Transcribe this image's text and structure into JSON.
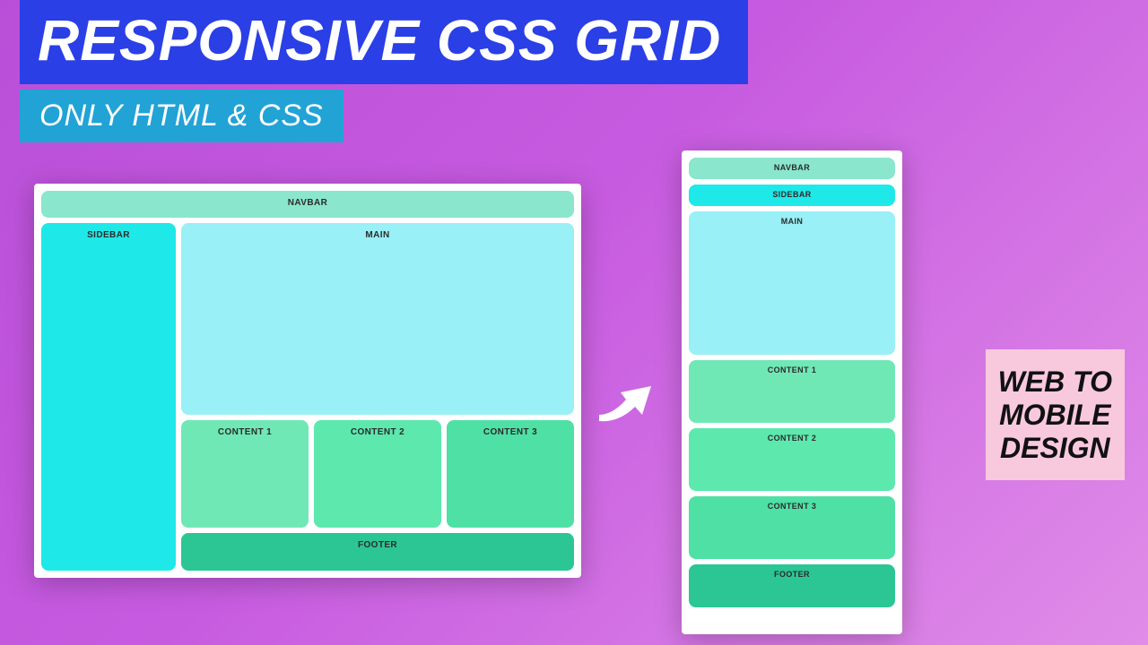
{
  "titles": {
    "main": "RESPONSIVE CSS GRID",
    "sub": "ONLY HTML & CSS"
  },
  "callout": {
    "line1": "WEB TO",
    "line2": "MOBILE",
    "line3": "DESIGN"
  },
  "layout": {
    "navbar": "NAVBAR",
    "sidebar": "SIDEBAR",
    "main": "MAIN",
    "content1": "CONTENT 1",
    "content2": "CONTENT 2",
    "content3": "CONTENT 3",
    "footer": "FOOTER"
  }
}
